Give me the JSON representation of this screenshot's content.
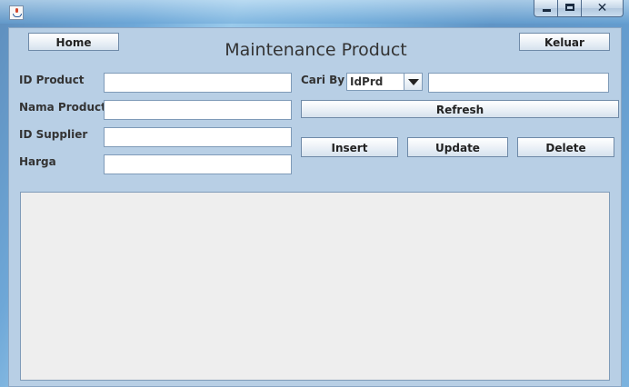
{
  "window": {
    "minimize_icon": "minimize-icon",
    "maximize_icon": "maximize-icon",
    "close_icon": "close-icon",
    "close_glyph": "✕",
    "app_icon": "java-cup-icon"
  },
  "header": {
    "title": "Maintenance Product",
    "home_label": "Home",
    "exit_label": "Keluar"
  },
  "form": {
    "id_product_label": "ID Product",
    "id_product_value": "",
    "nama_product_label": "Nama Product",
    "nama_product_value": "",
    "id_supplier_label": "ID Supplier",
    "id_supplier_value": "",
    "harga_label": "Harga",
    "harga_value": ""
  },
  "search": {
    "label": "Cari By",
    "selected": "IdPrd",
    "value": "",
    "refresh_label": "Refresh"
  },
  "actions": {
    "insert_label": "Insert",
    "update_label": "Update",
    "delete_label": "Delete"
  }
}
